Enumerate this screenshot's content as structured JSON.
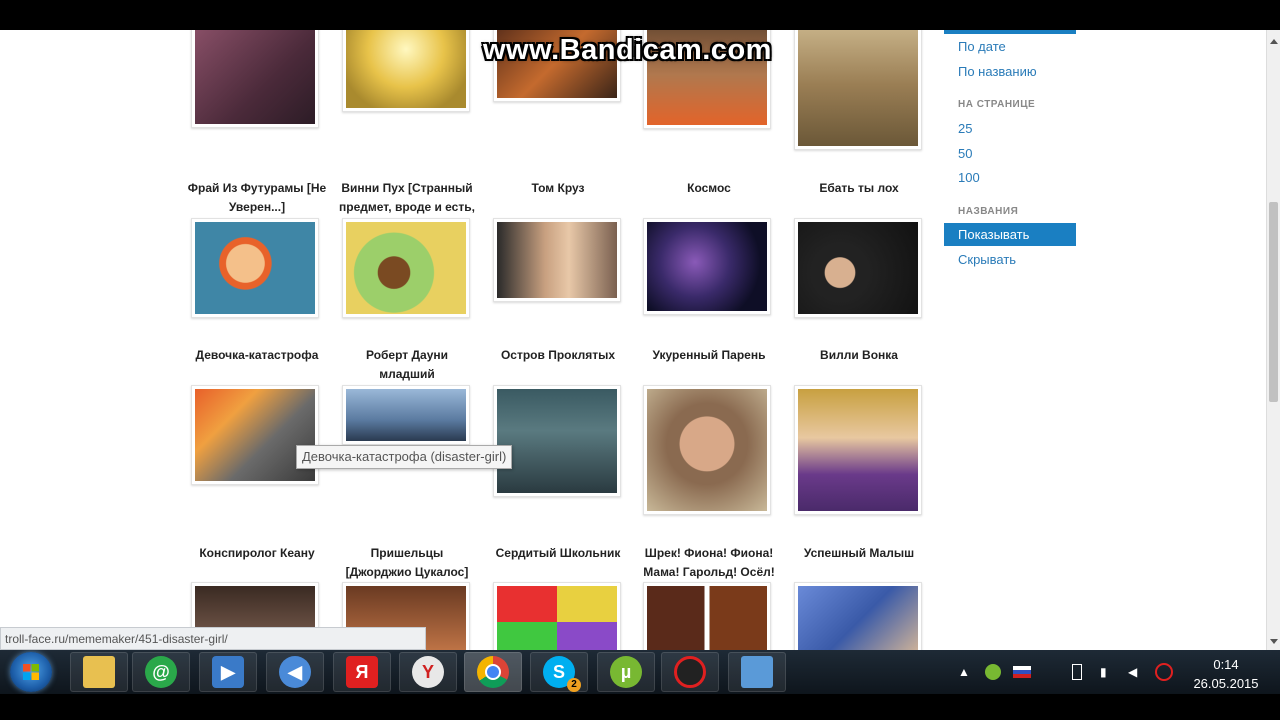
{
  "watermark": "www.Bandicam.com",
  "sidebar": {
    "sort_links": [
      "По дате",
      "По названию"
    ],
    "per_page_heading": "НА СТРАНИЦЕ",
    "per_page_options": [
      "25",
      "50",
      "100"
    ],
    "names_heading": "НАЗВАНИЯ",
    "names_show": "Показывать",
    "names_hide": "Скрывать"
  },
  "grid": {
    "row2_captions": [
      "Фрай Из Футурамы [Не Уверен...]",
      "Винни Пух [Странный предмет, вроде и есть,",
      "Том Круз",
      "Космос",
      "Ебать ты лох"
    ],
    "row3_captions": [
      "Девочка-катастрофа",
      "Роберт Дауни младший",
      "Остров Проклятых",
      "Укуренный Парень",
      "Вилли Вонка"
    ],
    "row4_captions": [
      "Конспиролог Кеану",
      "Пришельцы [Джорджио Цукалос]",
      "Сердитый Школьник",
      "Шрек! Фиона! Фиона! Мама! Гарольд! Осёл!",
      "Успешный Малыш"
    ]
  },
  "tooltip": "Девочка-катастрофа (disaster-girl)",
  "status_url": "troll-face.ru/mememaker/451-disaster-girl/",
  "taskbar": {
    "apps": [
      "explorer-icon",
      "mail-agent-icon",
      "media-player-icon",
      "sound-icon",
      "yandex-icon",
      "yandex-browser-icon",
      "chrome-icon",
      "skype-icon",
      "utorrent-icon",
      "bandicam-icon",
      "photo-viewer-icon"
    ],
    "skype_badge": "2",
    "time": "0:14",
    "date": "26.05.2015"
  }
}
